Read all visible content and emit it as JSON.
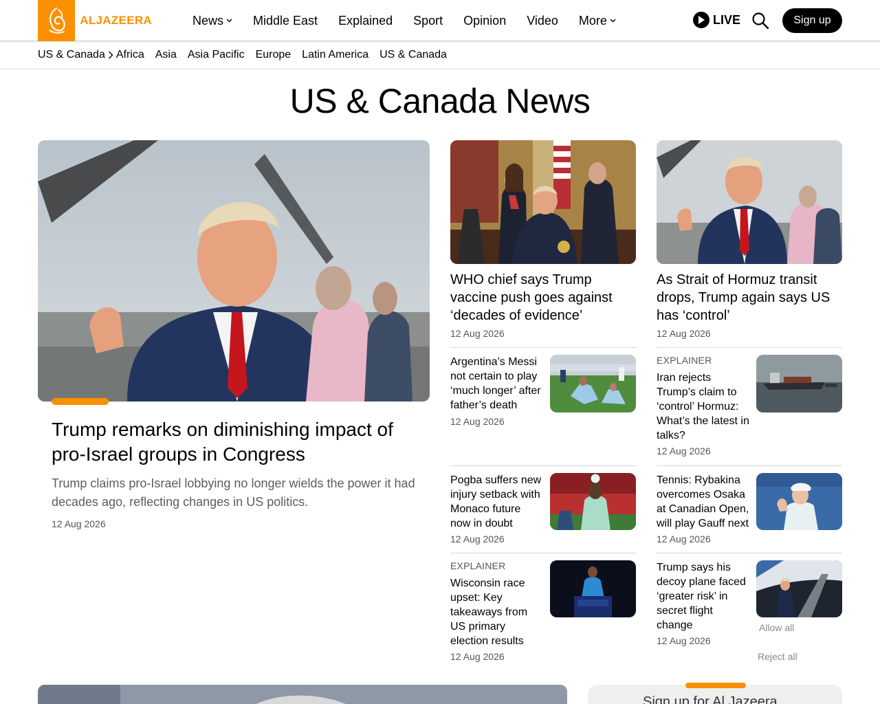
{
  "header": {
    "logo_text": "ALJAZEERA",
    "nav": [
      "News",
      "Middle East",
      "Explained",
      "Sport",
      "Opinion",
      "Video",
      "More"
    ],
    "live_label": "LIVE",
    "signup_label": "Sign up",
    "accent_color": "#fa9000"
  },
  "subnav": {
    "breadcrumb": "US & Canada",
    "items": [
      "Africa",
      "Asia",
      "Asia Pacific",
      "Europe",
      "Latin America",
      "US & Canada"
    ]
  },
  "page": {
    "title": "US & Canada News"
  },
  "featured": {
    "title": "Trump remarks on diminishing impact of pro-Israel groups in Congress",
    "summary": "Trump claims pro-Israel lobbying no longer wields the power it had decades ago, reflecting changes in US politics.",
    "date": "12 Aug 2026"
  },
  "top_stories": [
    {
      "title": "WHO chief says Trump vaccine push goes against ‘decades of evidence’",
      "date": "12 Aug 2026"
    },
    {
      "title": "As Strait of Hormuz transit drops, Trump again says US has ‘control’",
      "date": "12 Aug 2026"
    }
  ],
  "small_stories": [
    {
      "kicker": "",
      "title": "Argentina’s Messi not certain to play ‘much longer’ after father’s death",
      "date": "12 Aug 2026"
    },
    {
      "kicker": "EXPLAINER",
      "title": "Iran rejects Trump’s claim to ‘control’ Hormuz: What’s the latest in talks?",
      "date": "12 Aug 2026"
    },
    {
      "kicker": "",
      "title": "Pogba suffers new injury setback with Monaco future now in doubt",
      "date": "12 Aug 2026"
    },
    {
      "kicker": "",
      "title": "Tennis: Rybakina overcomes Osaka at Canadian Open, will play Gauff next",
      "date": "12 Aug 2026"
    },
    {
      "kicker": "EXPLAINER",
      "title": "Wisconsin race upset: Key takeaways from US primary election results",
      "date": "12 Aug 2026"
    },
    {
      "kicker": "",
      "title": "Trump says his decoy plane faced ‘greater risk’ in secret flight change",
      "date": "12 Aug 2026"
    }
  ],
  "consent": {
    "allow": "Allow all",
    "reject": "Reject all"
  },
  "newsletter": {
    "title": "Sign up for Al Jazeera"
  },
  "icons": [
    "logo-icon",
    "chevron-down-icon",
    "play-icon",
    "search-icon",
    "chevron-right-icon"
  ]
}
